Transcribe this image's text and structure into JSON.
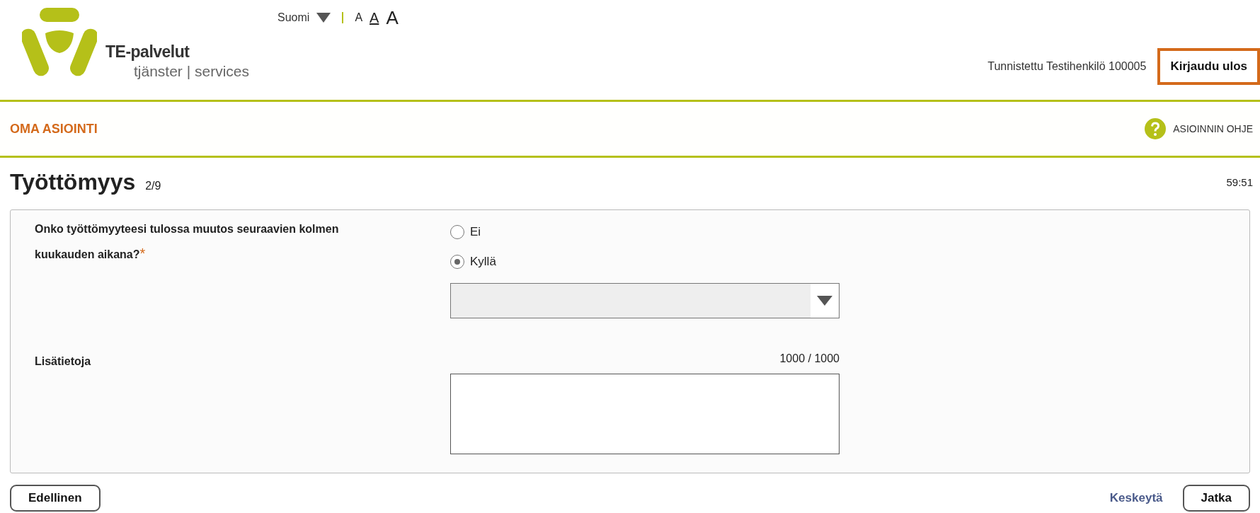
{
  "header": {
    "logo_title": "TE-palvelut",
    "logo_subtitle": "tjänster | services",
    "language": "Suomi",
    "font_sizes": [
      {
        "label": "A",
        "selected": false
      },
      {
        "label": "A",
        "selected": true
      },
      {
        "label": "A",
        "selected": false
      }
    ],
    "user": "Tunnistettu Testihenkilö 100005",
    "logout": "Kirjaudu ulos"
  },
  "nav": {
    "title": "OMA ASIOINTI",
    "help": "ASIOINNIN OHJE"
  },
  "page": {
    "title": "Työttömyys",
    "step": "2/9",
    "timer": "59:51"
  },
  "question": {
    "label": "Onko työttömyyteesi tulossa muutos seuraavien kolmen kuukauden aikana?",
    "required_mark": "*",
    "options": [
      {
        "label": "Ei",
        "selected": false
      },
      {
        "label": "Kyllä",
        "selected": true
      }
    ]
  },
  "extra": {
    "label": "Lisätietoja",
    "counter": "1000 / 1000"
  },
  "footer": {
    "back": "Edellinen",
    "cancel": "Keskeytä",
    "next": "Jatka"
  }
}
